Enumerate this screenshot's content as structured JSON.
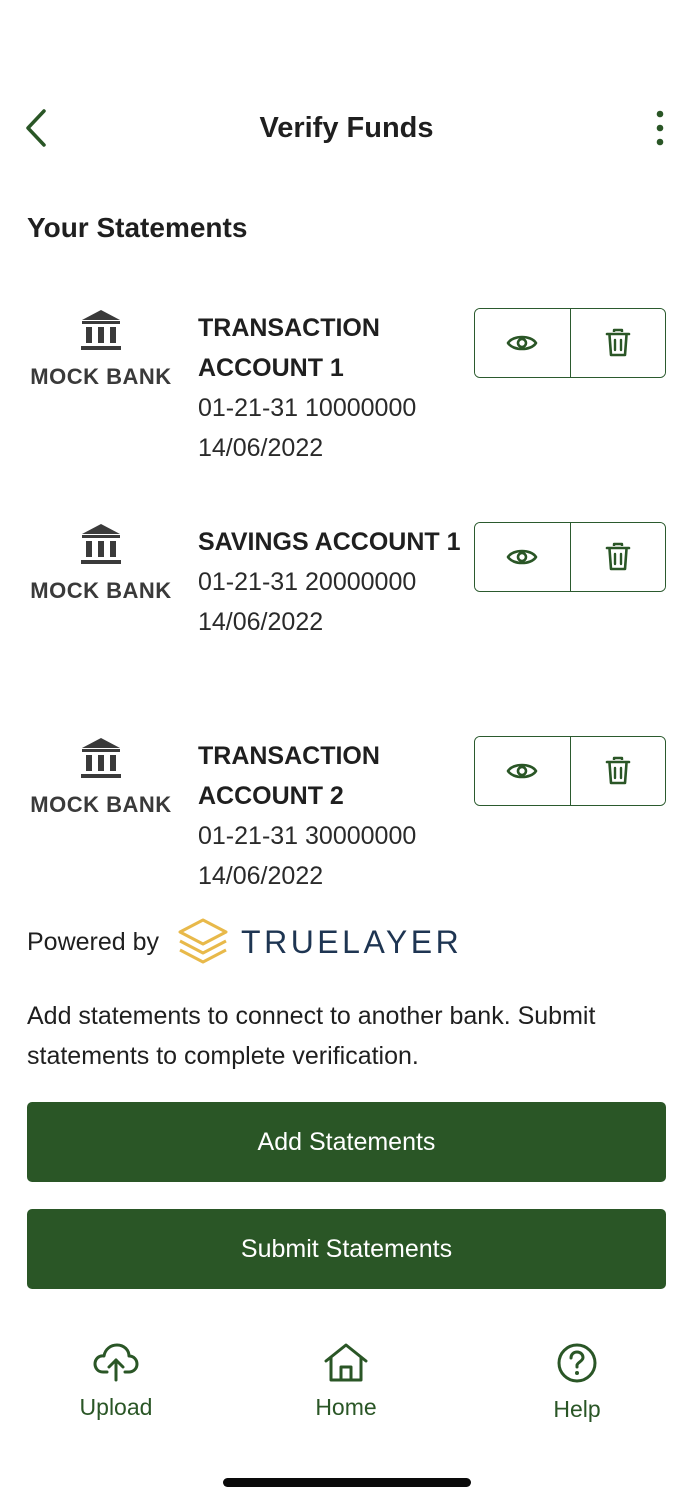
{
  "header": {
    "title": "Verify Funds"
  },
  "section_title": "Your Statements",
  "statements": [
    {
      "bank": "MOCK BANK",
      "name": "TRANSACTION ACCOUNT 1",
      "account": "01-21-31 10000000",
      "date": "14/06/2022"
    },
    {
      "bank": "MOCK BANK",
      "name": "SAVINGS ACCOUNT 1",
      "account": "01-21-31 20000000",
      "date": "14/06/2022"
    },
    {
      "bank": "MOCK BANK",
      "name": "TRANSACTION ACCOUNT 2",
      "account": "01-21-31 30000000",
      "date": "14/06/2022"
    }
  ],
  "powered": {
    "label": "Powered by",
    "brand": "TRUELAYER"
  },
  "helper_text": "Add statements to connect to another bank. Submit statements to complete verification.",
  "buttons": {
    "add": "Add Statements",
    "submit": "Submit Statements"
  },
  "nav": [
    {
      "label": "Upload",
      "icon": "cloud-upload-icon"
    },
    {
      "label": "Home",
      "icon": "home-icon"
    },
    {
      "label": "Help",
      "icon": "help-circle-icon"
    }
  ],
  "colors": {
    "accent": "#2a5626",
    "brand_gold": "#e8b94a",
    "brand_navy": "#1e3552"
  }
}
